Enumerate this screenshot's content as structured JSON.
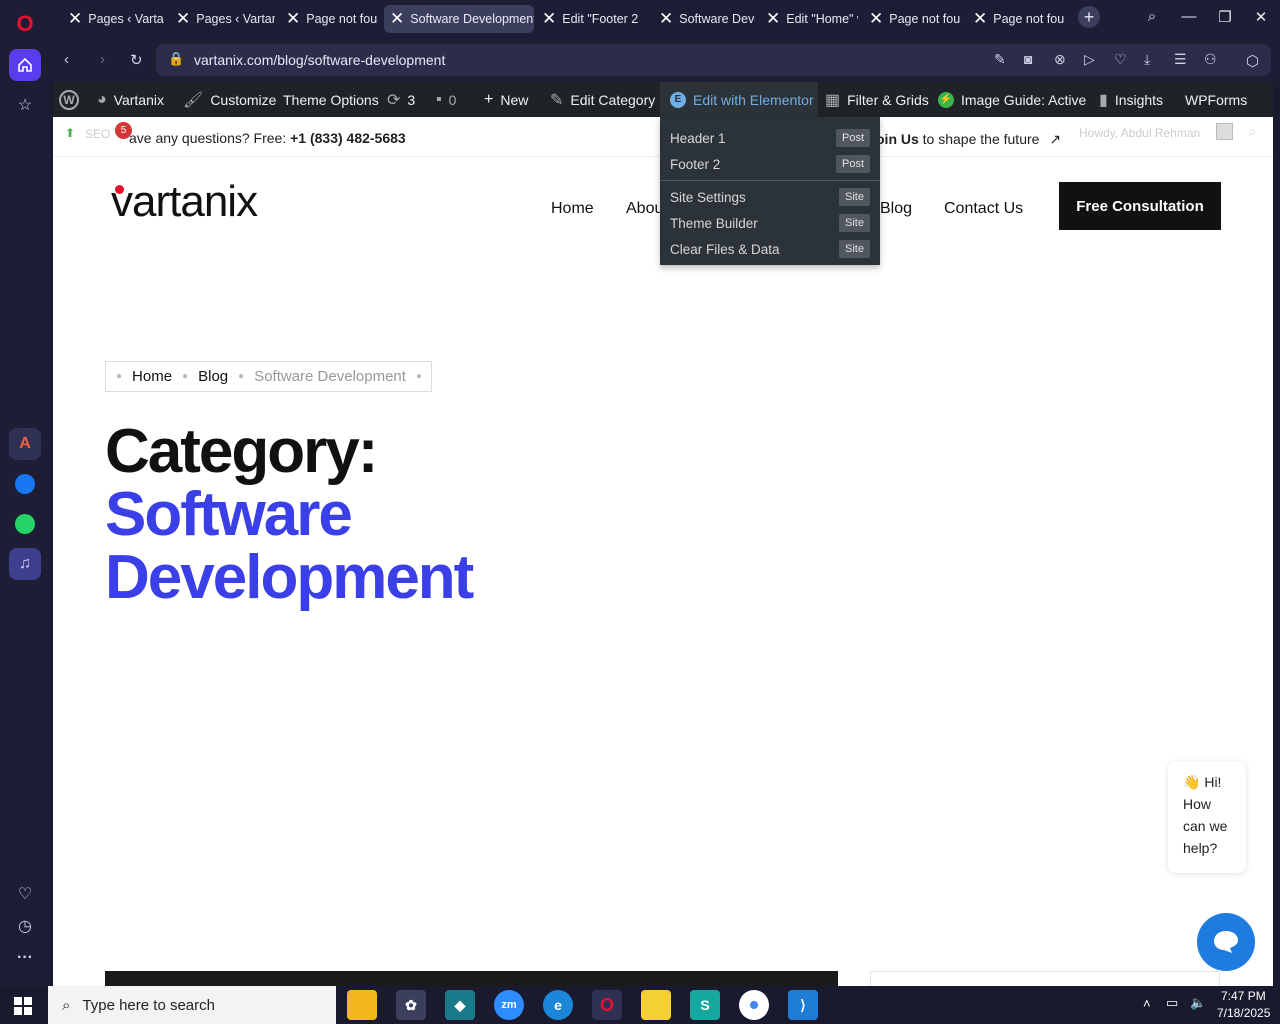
{
  "browser": {
    "tabs": [
      {
        "label": "Pages ‹ Vartar",
        "bar": "#e0455f",
        "active": false
      },
      {
        "label": "Pages ‹ Vartan",
        "bar": "",
        "active": false
      },
      {
        "label": "Page not foun",
        "bar": "",
        "active": false
      },
      {
        "label": "Software Development",
        "bar": "",
        "active": true
      },
      {
        "label": "Edit \"Footer 2",
        "bar": "",
        "active": false
      },
      {
        "label": "Software Deve",
        "bar": "#6b4cf0",
        "active": false
      },
      {
        "label": "Edit \"Home\" w",
        "bar": "",
        "active": false
      },
      {
        "label": "Page not foun",
        "bar": "",
        "active": false
      },
      {
        "label": "Page not foun",
        "bar": "",
        "active": false
      }
    ],
    "url": "vartanix.com/blog/software-development"
  },
  "wp_admin_bar": {
    "site_name": "Vartanix",
    "customize": "Customize",
    "theme_options": "Theme Options",
    "updates_count": "3",
    "comments_count": "0",
    "new": "New",
    "edit_category": "Edit Category",
    "edit_with_elementor": "Edit with Elementor",
    "filter_grids": "Filter & Grids",
    "image_guide": "Image Guide: Active",
    "insights": "Insights",
    "wpforms": "WPForms",
    "howdy": "Howdy, Abdul Rehman",
    "seo": "SEO",
    "seo_badge": "5"
  },
  "elementor_dropdown": [
    {
      "label": "Header 1",
      "badge": "Post"
    },
    {
      "label": "Footer 2",
      "badge": "Post"
    },
    {
      "label": "Site Settings",
      "badge": "Site"
    },
    {
      "label": "Theme Builder",
      "badge": "Site"
    },
    {
      "label": "Clear Files & Data",
      "badge": "Site"
    }
  ],
  "top_info": {
    "question_prefix": "ave any questions? Free: ",
    "phone": "+1 (833) 482-5683",
    "join_bold": "oin Us",
    "join_rest": " to shape the future"
  },
  "site": {
    "logo": "vartanix",
    "nav": [
      "Home",
      "Abou",
      "Blog",
      "Contact Us"
    ],
    "cta": "Free Consultation"
  },
  "breadcrumbs": [
    "Home",
    "Blog",
    "Software Development"
  ],
  "heading": {
    "line1": "Category:",
    "line2": "Software",
    "line3": "Development"
  },
  "chat": {
    "greeting_emoji": "👋",
    "greeting_lines": [
      "Hi!",
      "How",
      "can we",
      "help?"
    ]
  },
  "taskbar": {
    "search_placeholder": "Type here to search",
    "time": "7:47 PM",
    "date": "7/18/2025"
  },
  "colors": {
    "accent_blue": "#3b3fe8",
    "wp_bar": "#1d2327",
    "opera_red": "#e8102f",
    "browser_bg": "#1d1e35"
  }
}
